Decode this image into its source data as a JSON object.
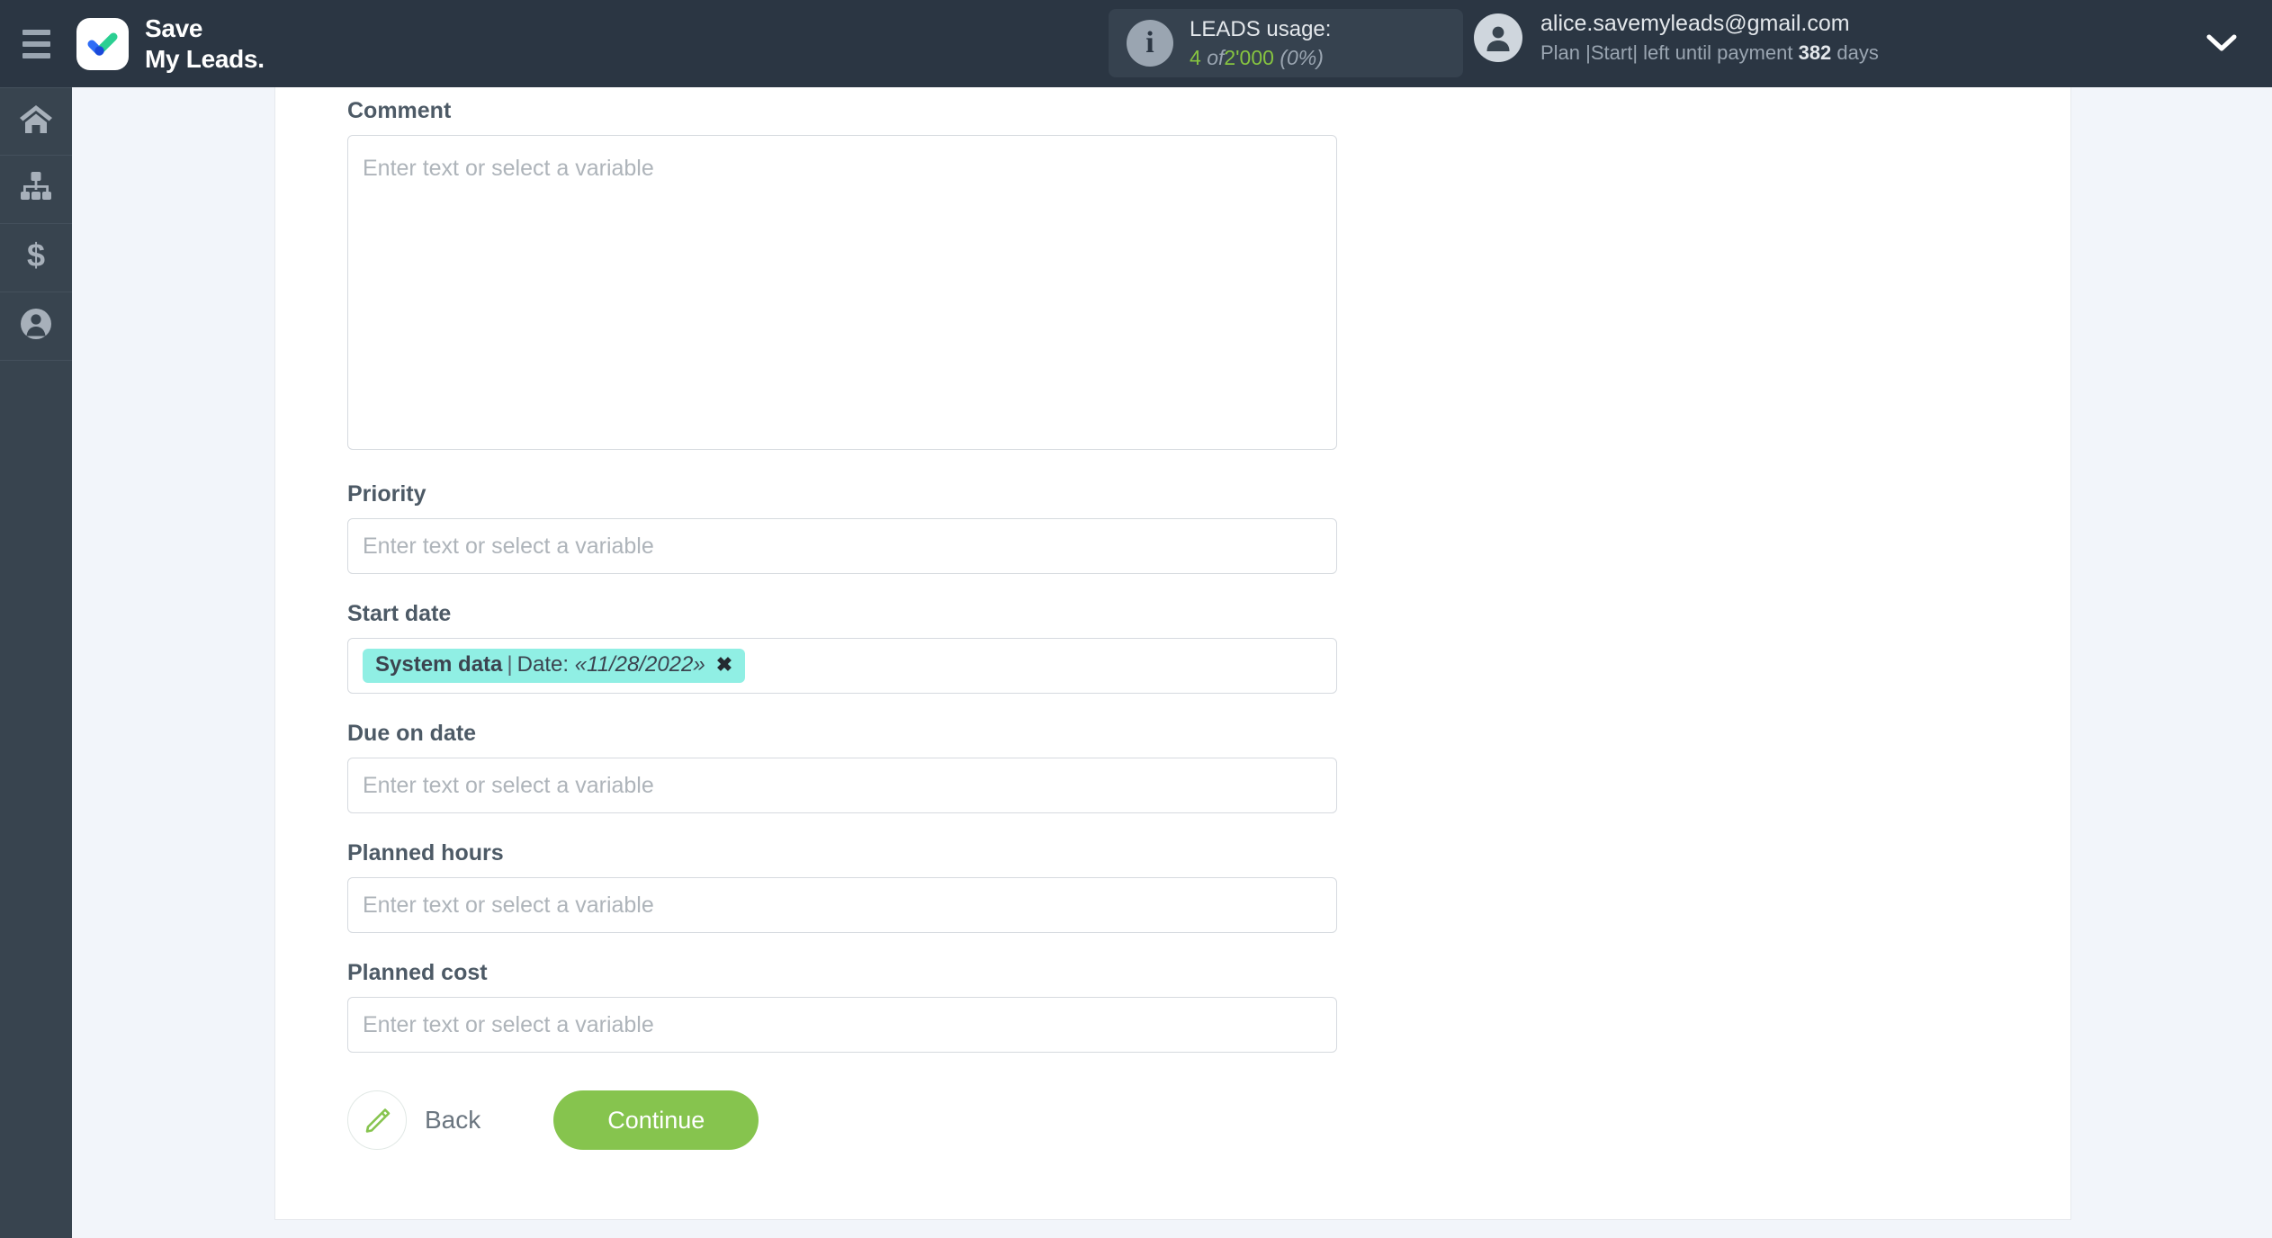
{
  "header": {
    "menu_icon": "hamburger-icon",
    "brand_name": "Save\nMy Leads.",
    "usage": {
      "icon": "info-icon",
      "title": "LEADS usage:",
      "used": "4",
      "of_word": "of",
      "total": "2'000",
      "percent": "(0%)"
    },
    "account": {
      "avatar_icon": "user-avatar-icon",
      "email": "alice.savemyleads@gmail.com",
      "plan_prefix": "Plan |Start| left until payment ",
      "days_value": "382",
      "plan_suffix": " days",
      "chevron_icon": "chevron-down-icon"
    }
  },
  "sidebar": {
    "items": [
      {
        "icon": "home-icon",
        "name": "sidebar-item-home"
      },
      {
        "icon": "sitemap-icon",
        "name": "sidebar-item-connections"
      },
      {
        "icon": "dollar-icon",
        "name": "sidebar-item-billing"
      },
      {
        "icon": "user-icon",
        "name": "sidebar-item-account"
      }
    ]
  },
  "form": {
    "placeholder": "Enter text or select a variable",
    "fields": [
      {
        "label": "Comment",
        "type": "textarea",
        "value": ""
      },
      {
        "label": "Priority",
        "type": "input",
        "value": ""
      },
      {
        "label": "Start date",
        "type": "chip",
        "value": ""
      },
      {
        "label": "Due on date",
        "type": "input",
        "value": ""
      },
      {
        "label": "Planned hours",
        "type": "input",
        "value": ""
      },
      {
        "label": "Planned cost",
        "type": "input",
        "value": ""
      }
    ],
    "chip": {
      "source": "System data",
      "separator": "|",
      "field_name": "Date:",
      "value": "«11/28/2022»",
      "remove_icon": "close-icon"
    },
    "back_label": "Back",
    "back_icon": "pencil-icon",
    "continue_label": "Continue"
  },
  "colors": {
    "header_bg": "#2b3643",
    "sidebar_bg": "#38444f",
    "page_bg": "#f2f5fa",
    "accent_green": "#86c44e",
    "usage_green": "#86c440",
    "chip_bg": "#90efe4"
  }
}
